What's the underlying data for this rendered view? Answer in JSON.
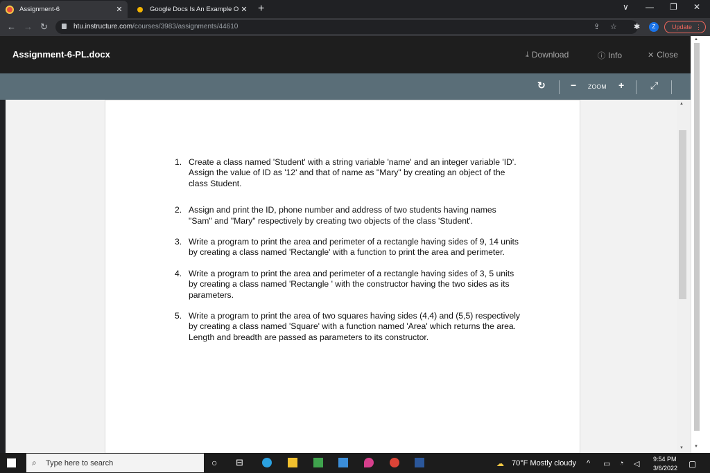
{
  "browser": {
    "tabs": [
      {
        "title": "Assignment-6",
        "active": true
      },
      {
        "title": "Google Docs Is An Example Of: C",
        "active": false
      }
    ],
    "new_tab_label": "+",
    "window_controls": {
      "dropdown": "∨",
      "minimize": "—",
      "maximize": "❐",
      "close": "✕"
    },
    "nav": {
      "back": "←",
      "forward": "→",
      "reload": "↻"
    },
    "url_host": "htu.instructure.com",
    "url_path": "/courses/3983/assignments/44610",
    "profile_initial": "Z",
    "update_label": "Update"
  },
  "preview": {
    "file_name": "Assignment-6-PL.docx",
    "download_label": "Download",
    "info_label": "Info",
    "close_label": "Close",
    "zoom_label": "ZOOM"
  },
  "document": {
    "questions": [
      {
        "num": "1.",
        "text": "Create a class named 'Student' with a string variable 'name' and an integer variable 'ID'. Assign the value of ID as '12' and that of name as \"Mary\" by creating an object of the class Student."
      },
      {
        "num": "2.",
        "text": "Assign and print the ID, phone number and address of two students having names \"Sam\" and \"Mary\" respectively by creating two objects of the class 'Student'."
      },
      {
        "num": "3.",
        "text": "Write a program to print the area and perimeter of a rectangle having sides of 9, 14 units by creating a class named 'Rectangle' with a function to print the area and perimeter."
      },
      {
        "num": "4.",
        "text": "Write a program to print the area and perimeter of a rectangle having sides of 3, 5 units by creating a class named 'Rectangle ' with the constructor having the two sides as its parameters."
      },
      {
        "num": "5.",
        "text": "Write a program to print the area of two squares having sides (4,4) and (5,5) respectively by creating a class named 'Square' with a function named 'Area' which returns the area. Length and breadth are passed as parameters to its constructor."
      }
    ]
  },
  "taskbar": {
    "search_placeholder": "Type here to search",
    "weather": "70°F  Mostly cloudy",
    "time": "9:54 PM",
    "date": "3/6/2022"
  },
  "colors": {
    "toolbar": "#5a6e78",
    "preview_header": "#1e1e1e",
    "update_accent": "#ee675c"
  }
}
